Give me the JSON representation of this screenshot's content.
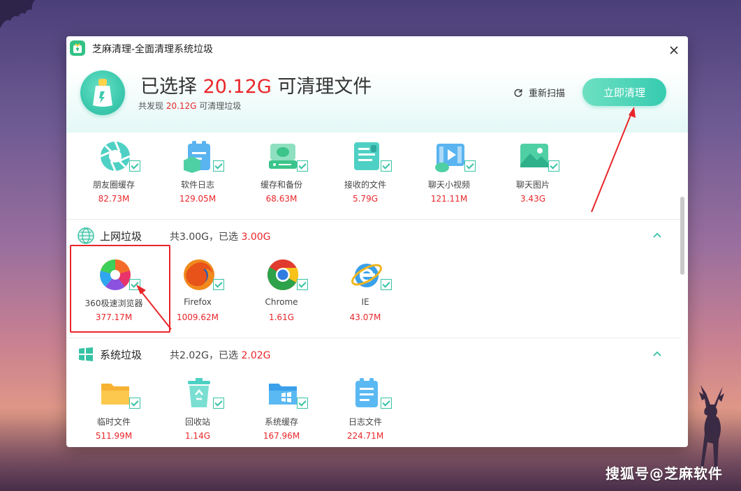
{
  "window": {
    "title": "芝麻清理-全面清理系统垃圾",
    "headline_prefix": "已选择 ",
    "headline_size": "20.12G",
    "headline_suffix": " 可清理文件",
    "subline_prefix": "共发现 ",
    "subline_size": "20.12G",
    "subline_suffix": " 可清理垃圾",
    "rescan_label": "重新扫描",
    "clean_label": "立即清理"
  },
  "wechat_items": [
    {
      "name": "朋友圈缓存",
      "size": "82.73M",
      "icon": "camera-aperture-icon"
    },
    {
      "name": "软件日志",
      "size": "129.05M",
      "icon": "clipboard-log-icon"
    },
    {
      "name": "缓存和备份",
      "size": "68.63M",
      "icon": "backup-drive-icon"
    },
    {
      "name": "接收的文件",
      "size": "5.79G",
      "icon": "received-file-icon"
    },
    {
      "name": "聊天小视频",
      "size": "121.11M",
      "icon": "video-icon"
    },
    {
      "name": "聊天图片",
      "size": "3.43G",
      "icon": "image-icon"
    }
  ],
  "web_section": {
    "title": "上网垃圾",
    "sum_prefix": "共3.00G，已选 ",
    "sum_selected": "3.00G",
    "items": [
      {
        "name": "360极速浏览器",
        "size": "377.17M",
        "icon": "360-browser-icon"
      },
      {
        "name": "Firefox",
        "size": "1009.62M",
        "icon": "firefox-icon"
      },
      {
        "name": "Chrome",
        "size": "1.61G",
        "icon": "chrome-icon"
      },
      {
        "name": "IE",
        "size": "43.07M",
        "icon": "ie-icon"
      }
    ]
  },
  "system_section": {
    "title": "系统垃圾",
    "sum_prefix": "共2.02G，已选 ",
    "sum_selected": "2.02G",
    "items": [
      {
        "name": "临时文件",
        "size": "511.99M",
        "icon": "temp-folder-icon"
      },
      {
        "name": "回收站",
        "size": "1.14G",
        "icon": "recycle-bin-icon"
      },
      {
        "name": "系统缓存",
        "size": "167.96M",
        "icon": "system-cache-folder-icon"
      },
      {
        "name": "日志文件",
        "size": "224.71M",
        "icon": "log-file-icon"
      }
    ]
  },
  "watermark": "搜狐号@芝麻软件",
  "colors": {
    "accent": "#36cbb0",
    "highlight_red": "#e8262a"
  }
}
